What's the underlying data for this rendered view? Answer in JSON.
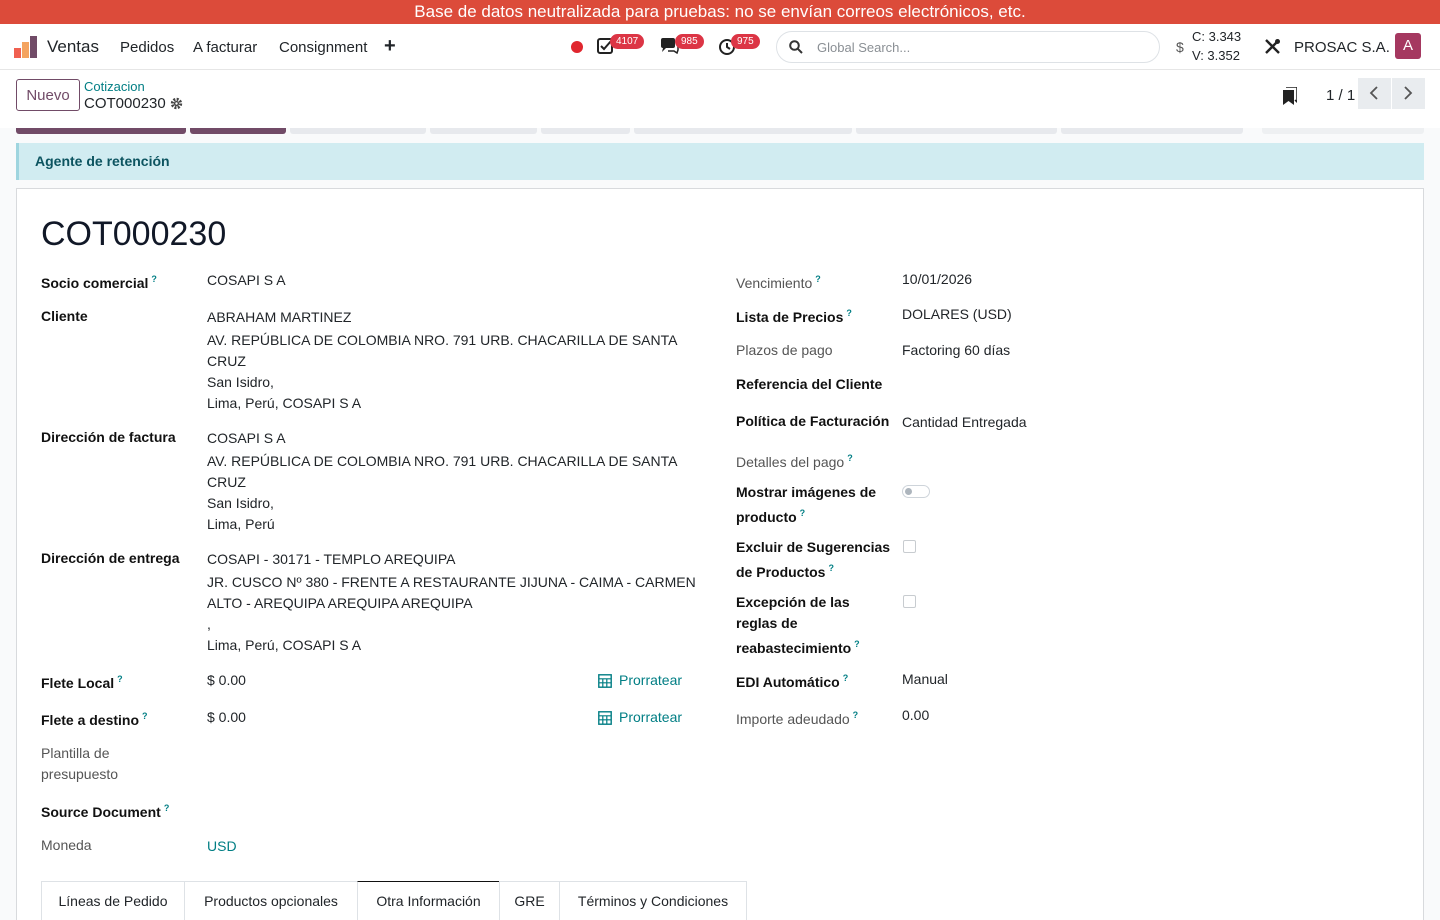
{
  "banner": "Base de datos neutralizada para pruebas: no se envían correos electrónicos, etc.",
  "navbar": {
    "app_name": "Ventas",
    "menu": [
      "Pedidos",
      "A facturar",
      "Consignment"
    ],
    "badges": {
      "activities": "4107",
      "messages": "985",
      "clock": "975"
    },
    "search_placeholder": "Global Search...",
    "rate_buy": "C: 3.343",
    "rate_sell": "V: 3.352",
    "rate_symbol": "$",
    "company": "PROSAC S.A.",
    "avatar_letter": "A"
  },
  "control": {
    "new_label": "Nuevo",
    "breadcrumb_parent": "Cotizacion",
    "breadcrumb_current": "COT000230",
    "pager": "1 / 1"
  },
  "alert": "Agente de retención",
  "form": {
    "title": "COT000230",
    "left": {
      "socio_label": "Socio comercial",
      "socio_value": "COSAPI S A",
      "cliente_label": "Cliente",
      "cliente_lines": [
        "ABRAHAM MARTINEZ",
        "AV. REPÚBLICA DE COLOMBIA NRO. 791 URB. CHACARILLA DE SANTA",
        "CRUZ",
        "San Isidro,",
        "Lima, Perú, COSAPI S A"
      ],
      "factura_label": "Dirección de factura",
      "factura_lines": [
        "COSAPI S A",
        "AV. REPÚBLICA DE COLOMBIA NRO. 791 URB. CHACARILLA DE SANTA",
        "CRUZ",
        "San Isidro,",
        "Lima, Perú"
      ],
      "entrega_label": "Dirección de entrega",
      "entrega_lines": [
        "COSAPI - 30171 - TEMPLO AREQUIPA",
        "JR. CUSCO Nº 380 - FRENTE A RESTAURANTE JIJUNA - CAIMA - CARMEN",
        "ALTO - AREQUIPA AREQUIPA AREQUIPA",
        ",",
        "Lima, Perú, COSAPI S A"
      ],
      "flete_local_label": "Flete Local",
      "flete_local_value": "$ 0.00",
      "flete_destino_label": "Flete a destino",
      "flete_destino_value": "$ 0.00",
      "prorratear_label": "Prorratear",
      "plantilla_label_1": "Plantilla de",
      "plantilla_label_2": "presupuesto",
      "source_label": "Source Document",
      "moneda_label": "Moneda",
      "moneda_value": "USD"
    },
    "right": {
      "vencimiento_label": "Vencimiento",
      "vencimiento_value": "10/01/2026",
      "lista_label": "Lista de Precios",
      "lista_value": "DOLARES (USD)",
      "plazos_label": "Plazos de pago",
      "plazos_value": "Factoring 60 días",
      "referencia_label": "Referencia del Cliente",
      "politica_label": "Política de Facturación",
      "politica_value": "Cantidad Entregada",
      "detalles_label": "Detalles del pago",
      "mostrar_label_1": "Mostrar imágenes de",
      "mostrar_label_2": "producto",
      "excluir_label_1": "Excluir de Sugerencias",
      "excluir_label_2": "de Productos",
      "excepcion_label_1": "Excepción de las",
      "excepcion_label_2": "reglas de",
      "excepcion_label_3": "reabastecimiento",
      "edi_label": "EDI Automático",
      "edi_value": "Manual",
      "importe_label": "Importe adeudado",
      "importe_value": "0.00"
    },
    "help_mark": "?"
  },
  "tabs": [
    "Líneas de Pedido",
    "Productos opcionales",
    "Otra Información",
    "GRE",
    "Términos y Condiciones"
  ],
  "colors": {
    "brand": "#714b67",
    "link": "#017e84",
    "banner": "#dc4b3a",
    "badge": "#dc3545",
    "alert_bg": "#d1ecf1"
  }
}
